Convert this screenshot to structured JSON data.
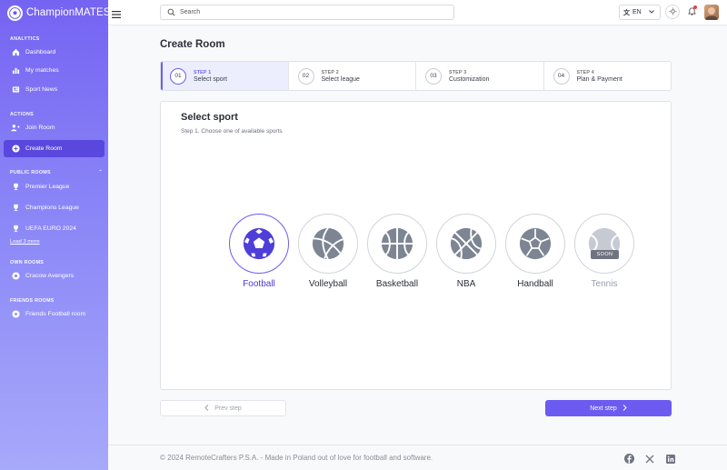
{
  "app": {
    "name": "ChampionMATES"
  },
  "sidebar": {
    "sections": {
      "analytics": "ANALYTICS",
      "actions": "ACTIONS",
      "public_rooms": "PUBLIC ROOMS",
      "own_rooms": "OWN ROOMS",
      "friends_rooms": "FRIENDS ROOMS"
    },
    "analytics_items": [
      {
        "label": "Dashboard",
        "icon": "home-icon"
      },
      {
        "label": "My matches",
        "icon": "chart-icon"
      },
      {
        "label": "Sport News",
        "icon": "news-icon"
      }
    ],
    "action_items": [
      {
        "label": "Join Room",
        "icon": "add-user-icon"
      },
      {
        "label": "Create Room",
        "icon": "plus-circle-icon",
        "active": true
      }
    ],
    "public_items": [
      {
        "label": "Premier League",
        "icon": "trophy-icon"
      },
      {
        "label": "Champions League",
        "icon": "trophy-icon"
      },
      {
        "label": "UEFA EURO 2024",
        "icon": "trophy-icon"
      }
    ],
    "load_more": "Load 3 more",
    "own_items": [
      {
        "label": "Cracow Avengers",
        "icon": "football-icon"
      }
    ],
    "friends_items": [
      {
        "label": "Friends Football room",
        "icon": "football-icon"
      }
    ]
  },
  "header": {
    "search_placeholder": "Search",
    "language": "EN"
  },
  "page": {
    "title": "Create Room"
  },
  "steps": [
    {
      "num": "01",
      "step": "STEP 1",
      "label": "Select sport",
      "active": true
    },
    {
      "num": "02",
      "step": "STEP 2",
      "label": "Select league"
    },
    {
      "num": "03",
      "step": "STEP 3",
      "label": "Customization"
    },
    {
      "num": "04",
      "step": "STEP 4",
      "label": "Plan & Payment"
    }
  ],
  "card": {
    "title": "Select sport",
    "subtitle": "Step 1. Choose one of available sports"
  },
  "sports": [
    {
      "label": "Football",
      "icon": "football-icon",
      "selected": true
    },
    {
      "label": "Volleyball",
      "icon": "volleyball-icon"
    },
    {
      "label": "Basketball",
      "icon": "basketball-icon"
    },
    {
      "label": "NBA",
      "icon": "basketball-icon"
    },
    {
      "label": "Handball",
      "icon": "handball-icon"
    },
    {
      "label": "Tennis",
      "icon": "tennis-icon",
      "disabled": true,
      "badge": "SOON"
    }
  ],
  "buttons": {
    "prev": "Prev step",
    "next": "Next step"
  },
  "footer": {
    "text": "© 2024 RemoteCrafters P.S.A. - Made in Poland out of love for football and software."
  },
  "colors": {
    "accent": "#6b5bf0",
    "sidebar_top": "#7563f2",
    "active_nav": "#5a48de"
  }
}
